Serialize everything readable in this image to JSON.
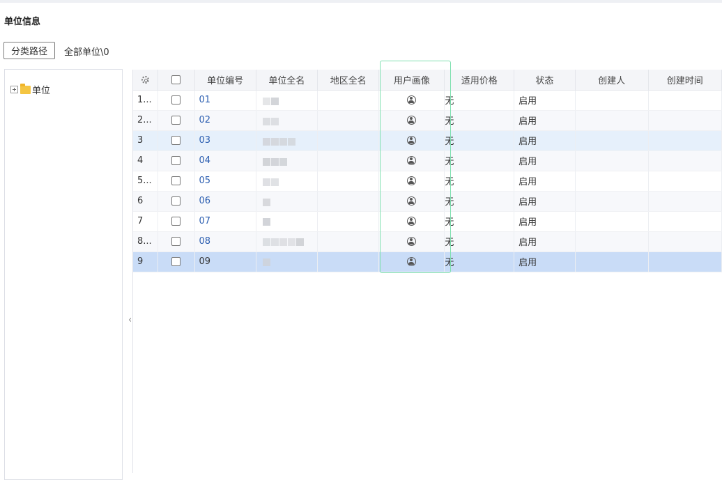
{
  "page": {
    "title": "单位信息"
  },
  "toolbar": {
    "path_button": "分类路径",
    "path_text": "全部单位\\0"
  },
  "tree": {
    "root_label": "单位"
  },
  "grid": {
    "columns": [
      "",
      "",
      "单位编号",
      "单位全名",
      "地区全名",
      "用户画像",
      "适用价格",
      "状态",
      "创建人",
      "创建时间"
    ],
    "rows": [
      {
        "idx": "1...",
        "code": "01",
        "name": "",
        "region": "",
        "price": "无",
        "status": "启用",
        "creator": "",
        "ctime": ""
      },
      {
        "idx": "2...",
        "code": "02",
        "name": "",
        "region": "",
        "price": "无",
        "status": "启用",
        "creator": "",
        "ctime": ""
      },
      {
        "idx": "3",
        "code": "03",
        "name": "",
        "region": "",
        "price": "无",
        "status": "启用",
        "creator": "",
        "ctime": ""
      },
      {
        "idx": "4",
        "code": "04",
        "name": "",
        "region": "",
        "price": "无",
        "status": "启用",
        "creator": "",
        "ctime": ""
      },
      {
        "idx": "5...",
        "code": "05",
        "name": "",
        "region": "",
        "price": "无",
        "status": "启用",
        "creator": "",
        "ctime": ""
      },
      {
        "idx": "6",
        "code": "06",
        "name": "",
        "region": "",
        "price": "无",
        "status": "启用",
        "creator": "",
        "ctime": ""
      },
      {
        "idx": "7",
        "code": "07",
        "name": "",
        "region": "",
        "price": "无",
        "status": "启用",
        "creator": "",
        "ctime": ""
      },
      {
        "idx": "8...",
        "code": "08",
        "name": "",
        "region": "",
        "price": "无",
        "status": "启用",
        "creator": "",
        "ctime": ""
      },
      {
        "idx": "9",
        "code": "09",
        "name": "",
        "region": "",
        "price": "无",
        "status": "启用",
        "creator": "",
        "ctime": ""
      }
    ],
    "highlighted_row": 2,
    "selected_row": 8
  },
  "icons": {
    "settings": "gear-icon",
    "user_portrait": "user-portrait-icon",
    "collapse": "chevron-left-icon"
  },
  "colors": {
    "link": "#2a5db0",
    "selected_row": "#c9dcf7",
    "hover_row": "#e6f0fb",
    "column_highlight": "#7fe0b0"
  }
}
